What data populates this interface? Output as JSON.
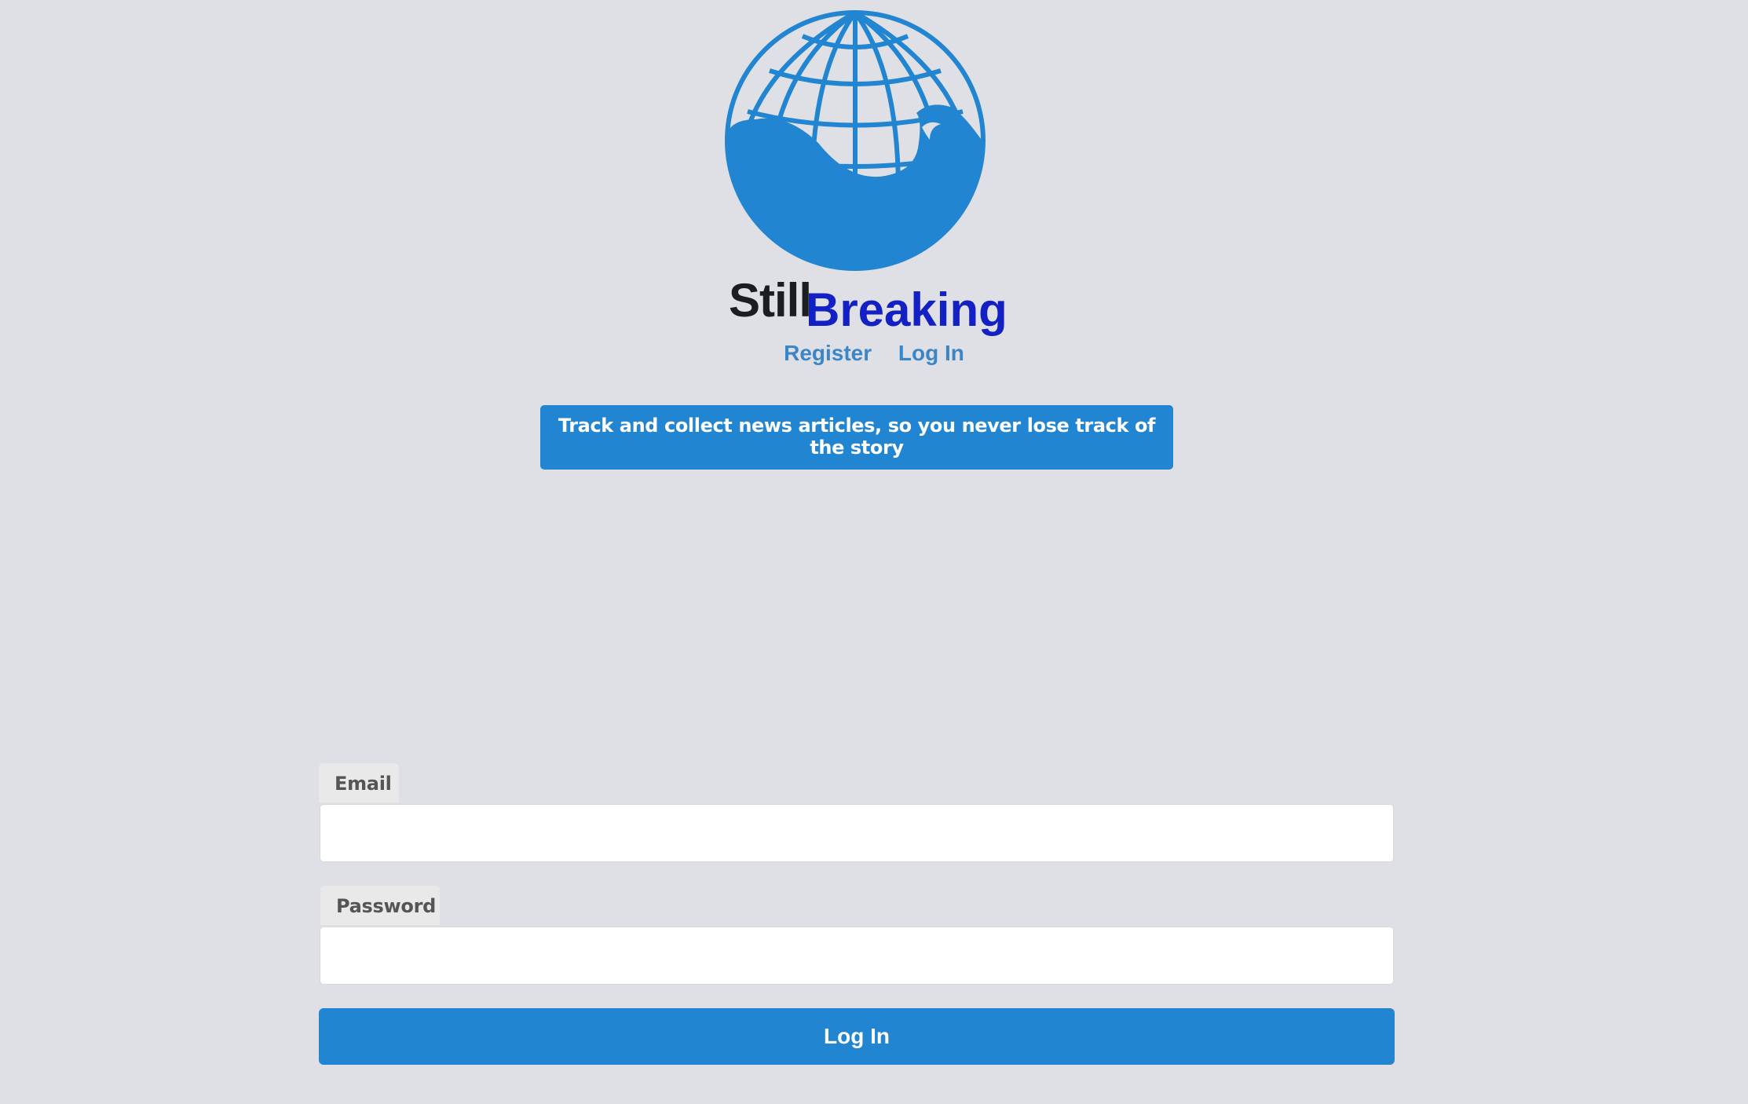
{
  "brand": {
    "still": "Still",
    "breaking": "Breaking",
    "logo_icon": "globe-wave-icon",
    "logo_color": "#2285d1"
  },
  "nav": {
    "register": "Register",
    "login": "Log In"
  },
  "tagline": "Track and collect news articles, so you never lose track of the story",
  "form": {
    "email_label": "Email",
    "email_value": "",
    "password_label": "Password",
    "password_value": "",
    "submit_label": "Log In"
  },
  "colors": {
    "background": "#dee0e5",
    "accent": "#2285d1",
    "brand_dark": "#1b1d20",
    "brand_blue": "#1320c3",
    "nav_link": "#3b86c8"
  }
}
